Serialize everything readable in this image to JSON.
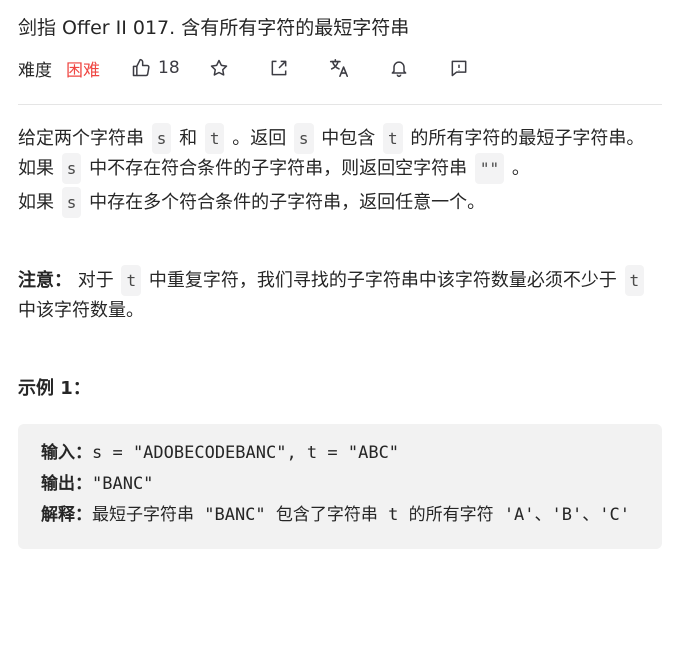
{
  "problem": {
    "title": "剑指 Offer II 017. 含有所有字符的最短字符串",
    "difficulty_label": "难度",
    "difficulty": "困难",
    "likes": "18"
  },
  "colors": {
    "difficulty_hard": "#ef4743",
    "code_bg": "#f3f3f4",
    "example_bg": "#f2f2f2"
  },
  "icons": {
    "like": "thumbs-up-icon",
    "star": "star-icon",
    "share": "share-icon",
    "translate": "translate-icon",
    "bell": "bell-icon",
    "feedback": "feedback-icon"
  },
  "desc": {
    "p1_a": "给定两个字符串 ",
    "p1_s": "s",
    "p1_b": " 和 ",
    "p1_t": "t",
    "p1_c": " 。返回 ",
    "p1_s2": "s",
    "p1_d": " 中包含 ",
    "p1_t2": "t",
    "p1_e": " 的所有字符的最短子字符串。如果 ",
    "p1_s3": "s",
    "p1_f": " 中不存在符合条件的子字符串，则返回空字符串 ",
    "p1_empty": "\"\"",
    "p1_g": " 。",
    "p2_a": "如果 ",
    "p2_s": "s",
    "p2_b": " 中存在多个符合条件的子字符串，返回任意一个。",
    "note_label": "注意：",
    "note_a": " 对于 ",
    "note_t": "t",
    "note_b": " 中重复字符，我们寻找的子字符串中该字符数量必须不少于 ",
    "note_t2": "t",
    "note_c": " 中该字符数量。"
  },
  "example1": {
    "title": "示例 1：",
    "input_label": "输入：",
    "input_value": "s = \"ADOBECODEBANC\", t = \"ABC\"",
    "output_label": "输出：",
    "output_value": "\"BANC\"",
    "explain_label": "解释：",
    "explain_value": "最短子字符串 \"BANC\" 包含了字符串 t 的所有字符 'A'、'B'、'C'"
  }
}
